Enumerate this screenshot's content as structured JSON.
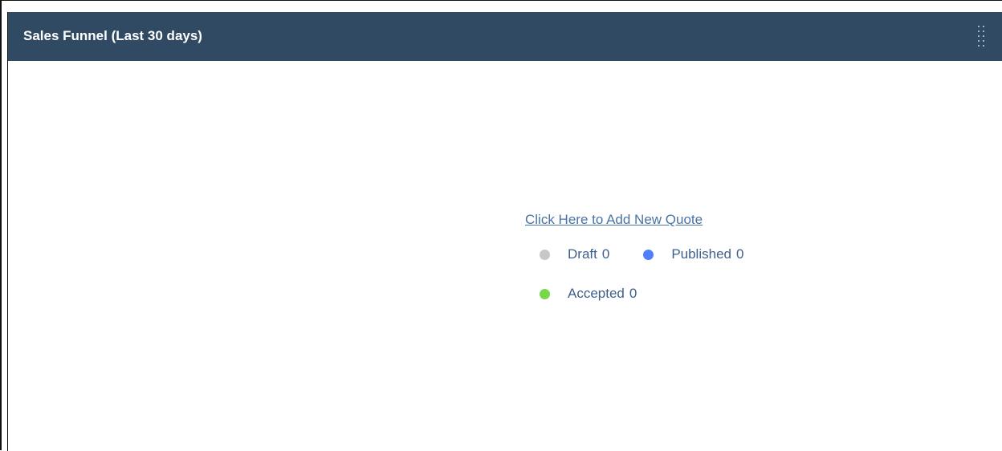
{
  "widget": {
    "title": "Sales Funnel (Last 30 days)",
    "menu_icon": "vertical-dots-grip-icon"
  },
  "funnel": {
    "add_quote_link": "Click Here to Add New Quote",
    "legend": [
      {
        "label": "Draft",
        "count": "0",
        "color": "#c7c7c7"
      },
      {
        "label": "Published",
        "count": "0",
        "color": "#4f7fff"
      },
      {
        "label": "Accepted",
        "count": "0",
        "color": "#79d84a"
      }
    ]
  },
  "colors": {
    "header_bg": "#2f4a62",
    "link": "#4a74a5",
    "legend_text": "#3e5f8a"
  }
}
